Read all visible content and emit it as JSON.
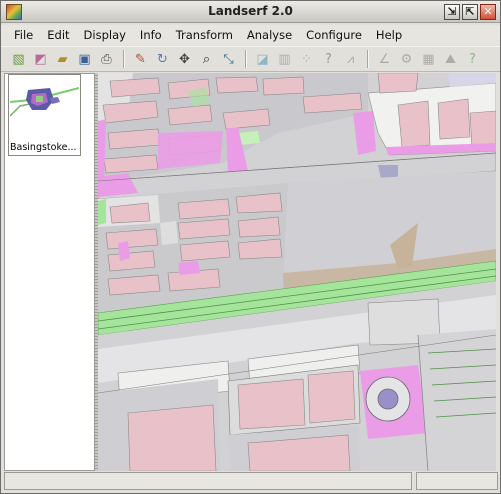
{
  "window": {
    "title": "Landserf 2.0"
  },
  "window_buttons": {
    "minimize": "⇲",
    "maximize": "⇱",
    "close": "✕"
  },
  "menu": [
    {
      "label": "File"
    },
    {
      "label": "Edit"
    },
    {
      "label": "Display"
    },
    {
      "label": "Info"
    },
    {
      "label": "Transform"
    },
    {
      "label": "Analyse"
    },
    {
      "label": "Configure"
    },
    {
      "label": "Help"
    }
  ],
  "toolbar": [
    {
      "name": "new-raster-icon",
      "glyph": "▧",
      "color": "#6a9a3c"
    },
    {
      "name": "new-vector-icon",
      "glyph": "◩",
      "color": "#b86a9c"
    },
    {
      "name": "open-folder-icon",
      "glyph": "▰",
      "color": "#b58b2f"
    },
    {
      "name": "save-disk-icon",
      "glyph": "▣",
      "color": "#3a5f9a"
    },
    {
      "name": "print-icon",
      "glyph": "⎙",
      "color": "#555555"
    },
    {
      "sep": true
    },
    {
      "name": "edit-pencil-icon",
      "glyph": "✎",
      "color": "#b0502a"
    },
    {
      "name": "rotate-icon",
      "glyph": "↻",
      "color": "#5b7fb0"
    },
    {
      "name": "pan-icon",
      "glyph": "✥",
      "color": "#444444"
    },
    {
      "name": "zoom-icon",
      "glyph": "⌕",
      "color": "#333333"
    },
    {
      "name": "measure-icon",
      "glyph": "⤡",
      "color": "#3a6e8a"
    },
    {
      "sep": true
    },
    {
      "name": "annotate-icon",
      "glyph": "◪",
      "color": "#3f8fb3",
      "disabled": true
    },
    {
      "name": "histogram-icon",
      "glyph": "▥",
      "color": "#777777",
      "disabled": true
    },
    {
      "name": "scatterplot-icon",
      "glyph": "⁘",
      "color": "#777777",
      "disabled": true
    },
    {
      "name": "query-icon",
      "glyph": "?",
      "color": "#555555",
      "disabled": true
    },
    {
      "name": "profile-icon",
      "glyph": "⩘",
      "color": "#777777",
      "disabled": true
    },
    {
      "sep": true
    },
    {
      "name": "angle-icon",
      "glyph": "∠",
      "color": "#777777",
      "disabled": true
    },
    {
      "name": "network-icon",
      "glyph": "⚙",
      "color": "#777777",
      "disabled": true
    },
    {
      "name": "grid-icon",
      "glyph": "▦",
      "color": "#777777",
      "disabled": true
    },
    {
      "name": "terrain-icon",
      "glyph": "⛰",
      "color": "#777777",
      "disabled": true
    },
    {
      "name": "help-icon",
      "glyph": "?",
      "color": "#3d8a3d",
      "disabled": true
    }
  ],
  "thumbnail": {
    "label": "Basingstoke..."
  },
  "status": {
    "left": "",
    "right": ""
  },
  "colors": {
    "road": "#d2d1d4",
    "building": "#e9c1c9",
    "pink_area": "#ea9de6",
    "green_strip": "#a5e59b",
    "tan": "#c7b39a",
    "light": "#efefee"
  }
}
